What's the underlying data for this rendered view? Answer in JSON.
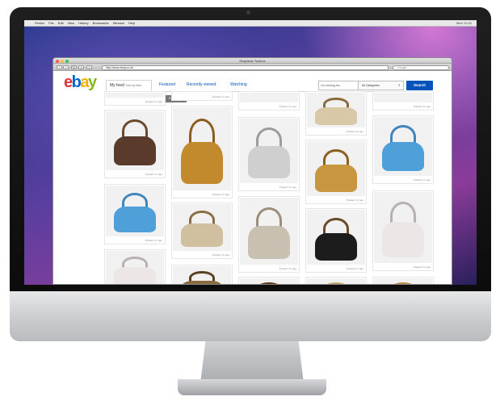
{
  "menubar": {
    "apple": "",
    "items": [
      "Firefox",
      "File",
      "Edit",
      "View",
      "History",
      "Bookmarks",
      "Window",
      "Help"
    ],
    "clock": "Wed 10:42"
  },
  "browser": {
    "window_title": "Shoptimiz Toolbox",
    "address": "http://www.ebay.co.uk",
    "search_placeholder": "Google"
  },
  "ebay": {
    "logo": [
      "e",
      "b",
      "a",
      "y"
    ],
    "tabs": [
      {
        "label": "My feed",
        "sublabel": "Edit my feed"
      },
      {
        "label": "Featured"
      },
      {
        "label": "Recently viewed"
      },
      {
        "label": "Watching"
      }
    ],
    "search_placeholder": "I'm looking for...",
    "category": "All Categories",
    "search_button": "Search",
    "crumb": "michael kors handbag",
    "follow_button": "Following"
  },
  "feed": {
    "posted_text": "Posted 1 hr ago",
    "items": [
      {
        "bag": "#7a7a78",
        "handle": "#c5a26b"
      },
      {
        "bag": "#5a3a2a",
        "handle": "#6b4a30"
      },
      {
        "bag": "#4f9fd9",
        "handle": "#3f86bf"
      },
      {
        "bag": "#ece6e6",
        "handle": "#b8b0b0"
      },
      {
        "bag": "#262626",
        "handle": "#c08a3e"
      },
      {
        "bag": "#c28a2c",
        "handle": "#8a5d21"
      },
      {
        "bag": "#d1c0a0",
        "handle": "#8a6d43"
      },
      {
        "bag": "#8a6b3c",
        "handle": "#5a4020"
      },
      {
        "bag": "#c49a4e",
        "handle": "#2a1d14"
      },
      {
        "bag": "#cfcfcf",
        "handle": "#9c9c9c"
      },
      {
        "bag": "#c8c1b1",
        "handle": "#9a8f78"
      },
      {
        "bag": "#9a5a28",
        "handle": "#5a3214"
      },
      {
        "bag": "#d8c8a8",
        "handle": "#8a6a3a"
      },
      {
        "bag": "#c89540",
        "handle": "#8a6021"
      },
      {
        "bag": "#1c1c1c",
        "handle": "#6b4a2a"
      }
    ]
  }
}
